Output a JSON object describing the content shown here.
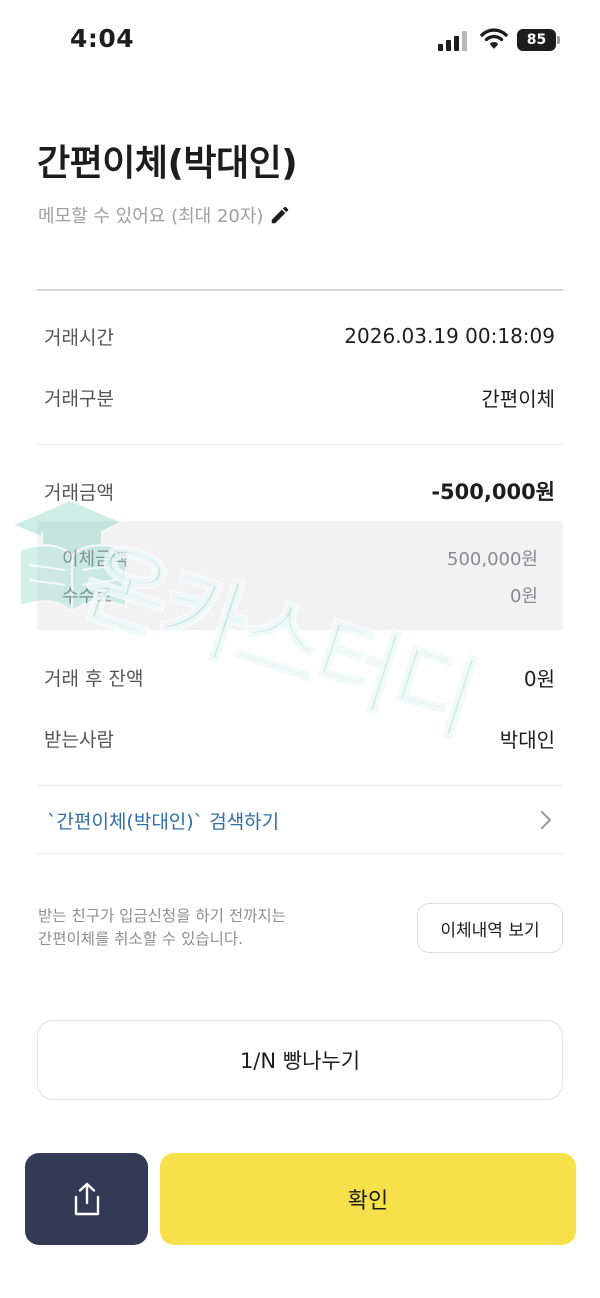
{
  "status_bar": {
    "time": "4:04",
    "battery": "85"
  },
  "header": {
    "title": "간편이체(박대인)",
    "memo_placeholder": "메모할 수 있어요 (최대 20자)"
  },
  "details": {
    "time_label": "거래시간",
    "time_value": "2026.03.19 00:18:09",
    "type_label": "거래구분",
    "type_value": "간편이체",
    "amount_label": "거래금액",
    "amount_value": "-500,000원",
    "transfer_label": "이체금액",
    "transfer_value": "500,000원",
    "fee_label": "수수료",
    "fee_value": "0원",
    "balance_label": "거래 후 잔액",
    "balance_value": "0원",
    "recipient_label": "받는사람",
    "recipient_value": "박대인"
  },
  "search_link": "`간편이체(박대인)` 검색하기",
  "notice": {
    "line1": "받는 친구가 입금신청을 하기 전까지는",
    "line2": "간편이체를 취소할 수 있습니다."
  },
  "buttons": {
    "history": "이체내역 보기",
    "split": "1/N 빵나누기",
    "confirm": "확인"
  },
  "watermark": "온카스터디",
  "colors": {
    "confirm_bg": "#f7e14a",
    "share_bg": "#323a55",
    "link": "#2f6fa8"
  },
  "icons": [
    "signal-icon",
    "wifi-icon",
    "pencil-icon",
    "chevron-right-icon",
    "share-icon",
    "graduation-book-icon"
  ]
}
